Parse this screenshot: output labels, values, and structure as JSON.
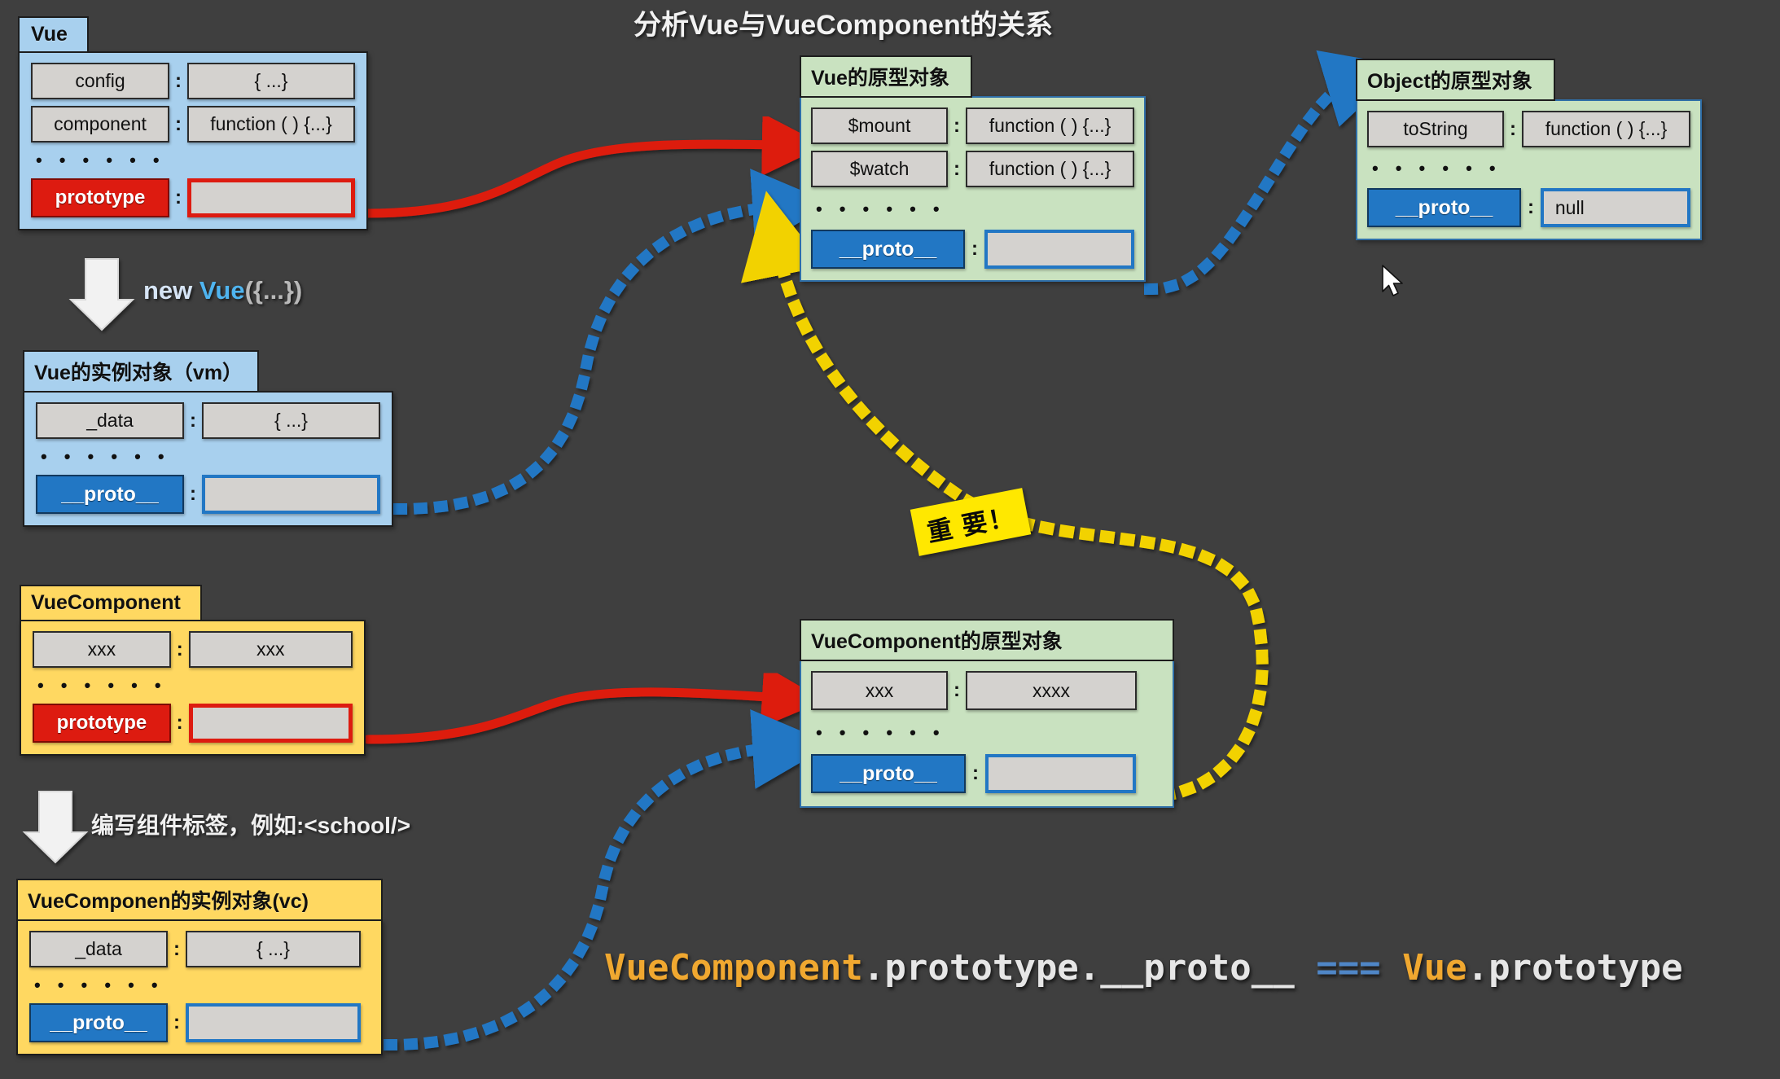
{
  "title": "分析Vue与VueComponent的关系",
  "colors": {
    "background": "#3f3f3f",
    "blue_card": "#a8d0ee",
    "green_card": "#c9e2c0",
    "yellow_card": "#ffd861",
    "proto_key": "#2277c4",
    "prototype_key": "#dd1b10",
    "red_arrow": "#dd1b10",
    "blue_arrow": "#2277c4",
    "yellow_arrow": "#f2d200",
    "sticker": "#ffe800"
  },
  "cards": {
    "vue": {
      "tab": "Vue",
      "rows": [
        {
          "key": "config",
          "colon": ":",
          "value": "{ ...}"
        },
        {
          "key": "component",
          "colon": ":",
          "value": "function ( ) {...}"
        }
      ],
      "ellipsis": "• • • • • •",
      "proto_row": {
        "key": "prototype",
        "colon": ":",
        "value": ""
      }
    },
    "vue_instance": {
      "tab": "Vue的实例对象（vm）",
      "rows": [
        {
          "key": "_data",
          "colon": ":",
          "value": "{ ...}"
        }
      ],
      "ellipsis": "• • • • • •",
      "proto_row": {
        "key": "__proto__",
        "colon": ":",
        "value": ""
      }
    },
    "vue_component": {
      "tab": "VueComponent",
      "rows": [
        {
          "key": "xxx",
          "colon": ":",
          "value": "xxx"
        }
      ],
      "ellipsis": "• • • • • •",
      "proto_row": {
        "key": "prototype",
        "colon": ":",
        "value": ""
      }
    },
    "vue_component_instance": {
      "tab": "VueComponen的实例对象(vc)",
      "rows": [
        {
          "key": "_data",
          "colon": ":",
          "value": "{ ...}"
        }
      ],
      "ellipsis": "• • • • • •",
      "proto_row": {
        "key": "__proto__",
        "colon": ":",
        "value": ""
      }
    },
    "vue_prototype": {
      "tab": "Vue的原型对象",
      "rows": [
        {
          "key": "$mount",
          "colon": ":",
          "value": "function ( ) {...}"
        },
        {
          "key": "$watch",
          "colon": ":",
          "value": "function ( ) {...}"
        }
      ],
      "ellipsis": "• • • • • •",
      "proto_row": {
        "key": "__proto__",
        "colon": ":",
        "value": ""
      }
    },
    "object_prototype": {
      "tab": "Object的原型对象",
      "rows": [
        {
          "key": "toString",
          "colon": ":",
          "value": "function ( ) {...}"
        }
      ],
      "ellipsis": "• • • • • •",
      "proto_row": {
        "key": "__proto__",
        "colon": ":",
        "value": "null"
      }
    },
    "vue_component_prototype": {
      "tab": "VueComponent的原型对象",
      "rows": [
        {
          "key": "xxx",
          "colon": ":",
          "value": "xxxx"
        }
      ],
      "ellipsis": "• • • • • •",
      "proto_row": {
        "key": "__proto__",
        "colon": ":",
        "value": ""
      }
    }
  },
  "annotations": {
    "new_vue": {
      "kw": "new ",
      "ctor": "Vue",
      "args": "({...})"
    },
    "write_component_tag": "编写组件标签，例如:<school/>",
    "important": "重 要！"
  },
  "formula": {
    "part1": "VueComponent",
    "part2": ".prototype.__proto__",
    "part3": "===",
    "part4": "Vue",
    "part5": ".prototype"
  }
}
